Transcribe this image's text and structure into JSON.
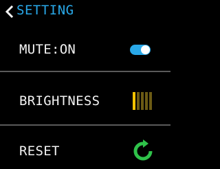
{
  "header": {
    "title": "SETTING",
    "back_icon": "chevron-left-icon",
    "accent_color": "#29a8e8"
  },
  "rows": {
    "mute": {
      "label": "MUTE:ON",
      "toggle_on": true,
      "toggle_color": "#29a8e8"
    },
    "brightness": {
      "label": "BRIGHTNESS",
      "level": 1,
      "max_level": 5,
      "active_color": "#f2c200",
      "inactive_color": "#6b5a14"
    },
    "reset": {
      "label": "RESET",
      "icon": "refresh-icon",
      "icon_color": "#2fc24a"
    }
  }
}
